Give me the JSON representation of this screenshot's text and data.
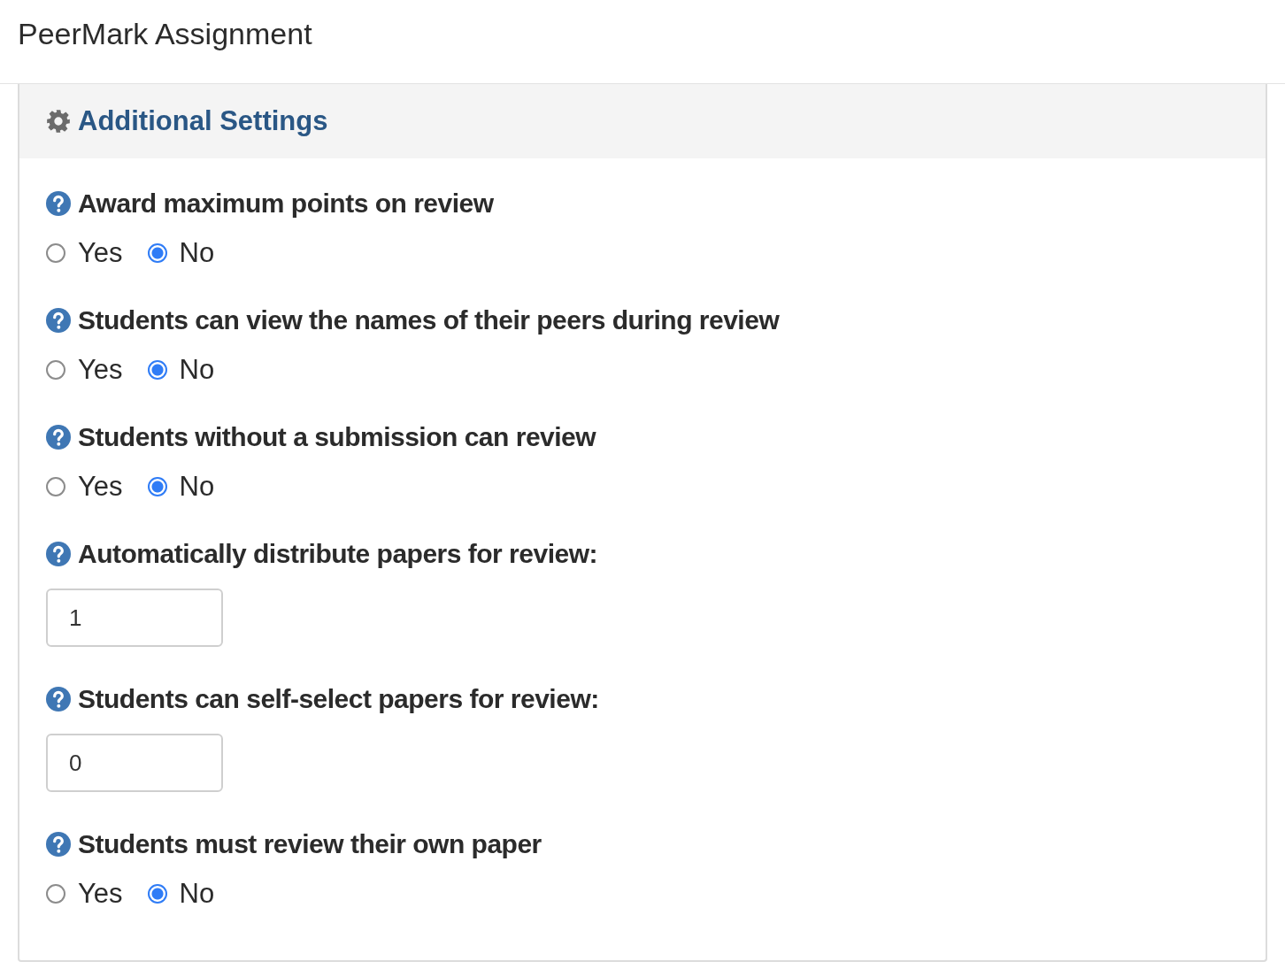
{
  "page": {
    "title": "PeerMark Assignment"
  },
  "panel": {
    "heading": "Additional Settings",
    "settings": [
      {
        "kind": "radio",
        "label": "Award maximum points on review",
        "options": [
          {
            "label": "Yes",
            "selected": false
          },
          {
            "label": "No",
            "selected": true
          }
        ]
      },
      {
        "kind": "radio",
        "label": "Students can view the names of their peers during review",
        "options": [
          {
            "label": "Yes",
            "selected": false
          },
          {
            "label": "No",
            "selected": true
          }
        ]
      },
      {
        "kind": "radio",
        "label": "Students without a submission can review",
        "options": [
          {
            "label": "Yes",
            "selected": false
          },
          {
            "label": "No",
            "selected": true
          }
        ]
      },
      {
        "kind": "number",
        "label": "Automatically distribute papers for review:",
        "value": "1"
      },
      {
        "kind": "number",
        "label": "Students can self-select papers for review:",
        "value": "0"
      },
      {
        "kind": "radio",
        "label": "Students must review their own paper",
        "options": [
          {
            "label": "Yes",
            "selected": false
          },
          {
            "label": "No",
            "selected": true
          }
        ]
      }
    ]
  }
}
